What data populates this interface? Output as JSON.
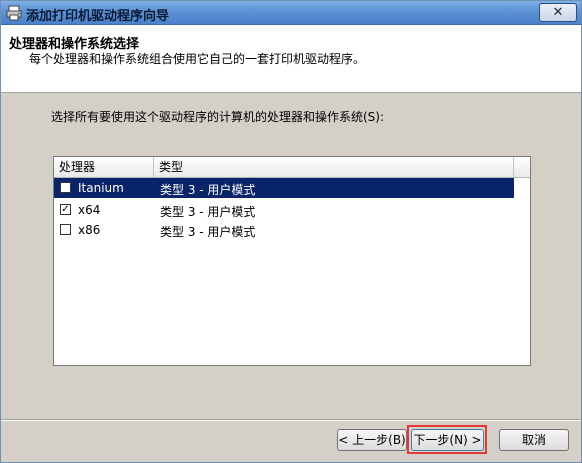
{
  "window": {
    "title": "添加打印机驱动程序向导",
    "close_label": "✕"
  },
  "header": {
    "title": "处理器和操作系统选择",
    "subtitle": "每个处理器和操作系统组合使用它自己的一套打印机驱动程序。"
  },
  "instruction": "选择所有要使用这个驱动程序的计算机的处理器和操作系统(S):",
  "list": {
    "columns": [
      "处理器",
      "类型"
    ],
    "rows": [
      {
        "processor": "Itanium",
        "type": "类型 3 - 用户模式",
        "checked": false,
        "selected": true
      },
      {
        "processor": "x64",
        "type": "类型 3 - 用户模式",
        "checked": true,
        "selected": false
      },
      {
        "processor": "x86",
        "type": "类型 3 - 用户模式",
        "checked": false,
        "selected": false
      }
    ]
  },
  "buttons": {
    "back": "< 上一步(B)",
    "next": "下一步(N) >",
    "cancel": "取消"
  },
  "colors": {
    "selection": "#0a246a",
    "highlight": "#e53935"
  }
}
